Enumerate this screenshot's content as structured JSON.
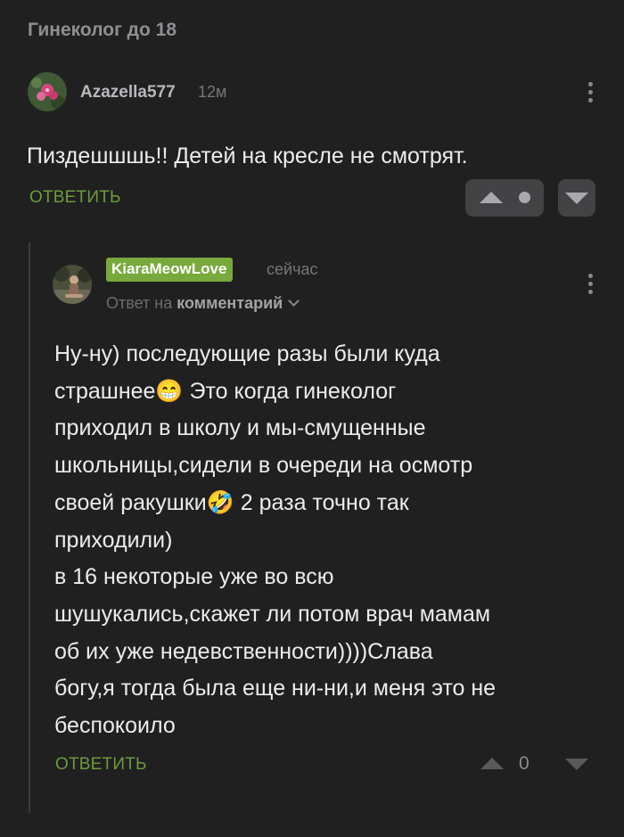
{
  "post": {
    "title": "Гинеколог до 18"
  },
  "comment1": {
    "username": "Azazella577",
    "time": "12м",
    "text": "Пиздешшшь!! Детей на кресле не смотрят.",
    "reply_label": "ОТВЕТИТЬ"
  },
  "comment2": {
    "username": "KiaraMeowLove",
    "time": "сейчас",
    "reply_to_prefix": "Ответ на",
    "reply_to_target": "комментарий",
    "lines": [
      "Ну-ну) последующие разы были куда",
      "страшнее😁 Это когда гинеколог",
      "приходил в школу и мы-смущенные",
      "школьницы,сидели в очереди на осмотр",
      "своей ракушки🤣 2 раза точно так",
      "приходили)",
      "в 16 некоторые уже во всю",
      "шушукались,скажет ли потом врач мамам",
      "об их уже недевственности))))Слава",
      "богу,я тогда была еще ни-ни,и меня это не",
      "беспокоило"
    ],
    "reply_label": "ОТВЕТИТЬ",
    "score": "0"
  },
  "colors": {
    "background": "#202021",
    "accent_green": "#6b9b3a",
    "badge_green": "#78a93c"
  }
}
